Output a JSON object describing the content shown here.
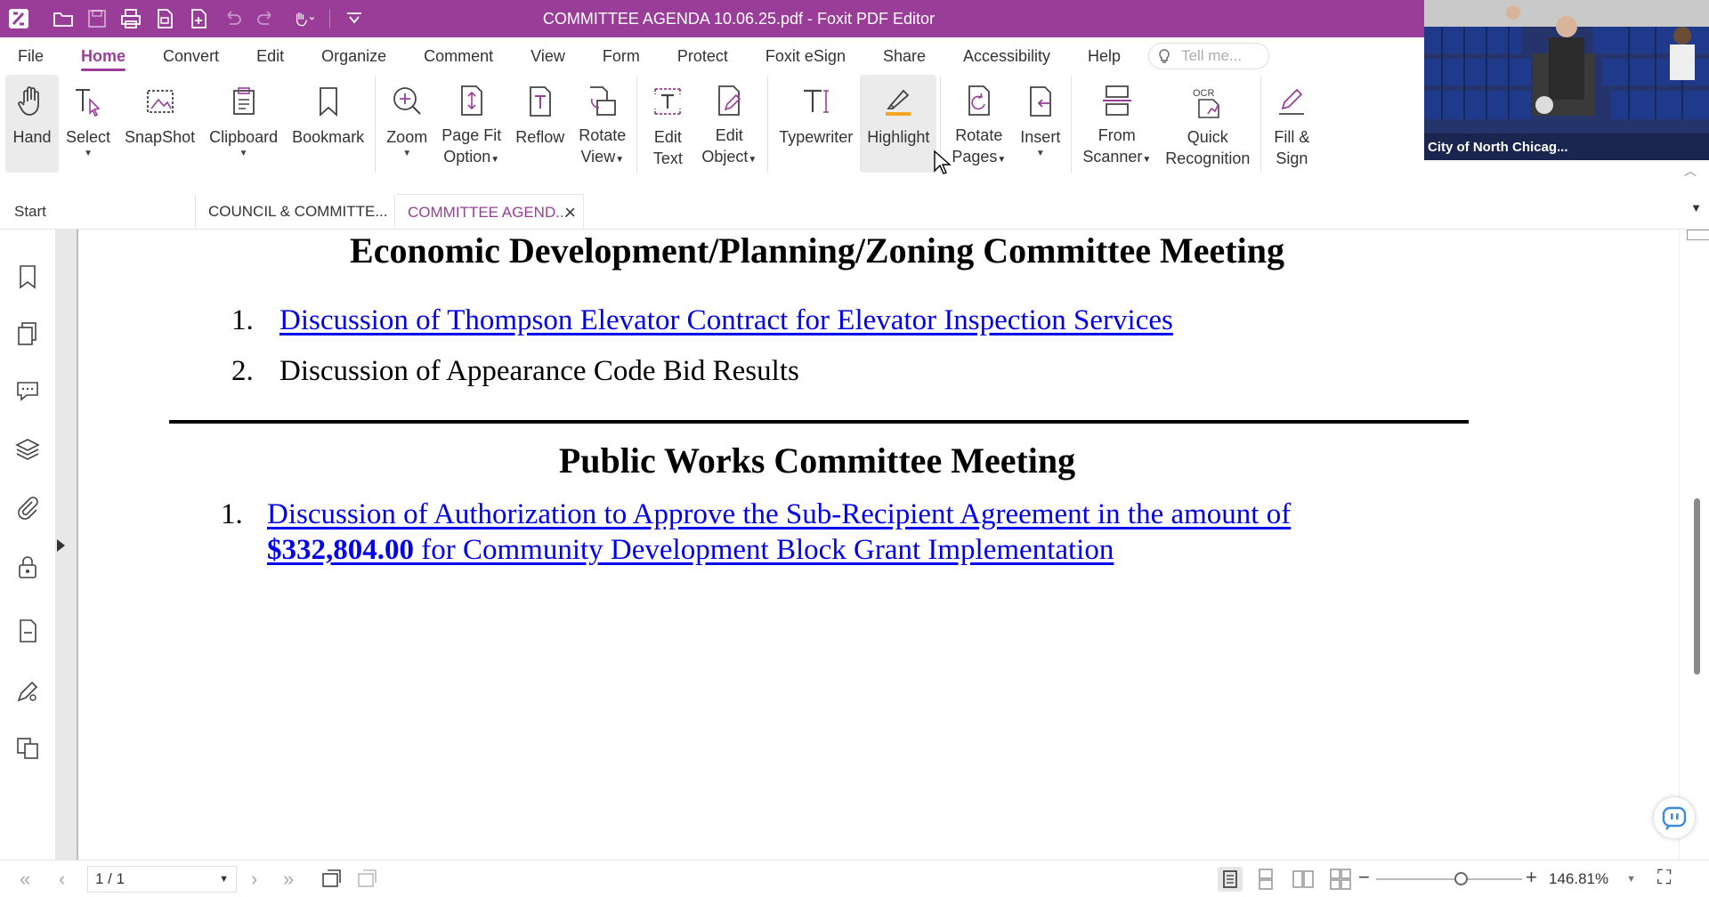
{
  "window": {
    "title": "COMMITTEE AGENDA 10.06.25.pdf - Foxit PDF Editor",
    "accent_color": "#993d99"
  },
  "quick_access": [
    "foxit-logo-icon",
    "open-folder-icon",
    "save-icon",
    "print-icon",
    "new-doc-icon",
    "create-icon",
    "undo-icon",
    "redo-icon",
    "hand-tool-icon",
    "customize-icon"
  ],
  "menu": {
    "items": [
      "File",
      "Home",
      "Convert",
      "Edit",
      "Organize",
      "Comment",
      "View",
      "Form",
      "Protect",
      "Foxit eSign",
      "Share",
      "Accessibility",
      "Help"
    ],
    "active": "Home",
    "tell_me_placeholder": "Tell me..."
  },
  "ribbon": {
    "hand": "Hand",
    "select": "Select",
    "snapshot": "SnapShot",
    "clipboard": "Clipboard",
    "bookmark": "Bookmark",
    "zoom": "Zoom",
    "page_fit_1": "Page Fit",
    "page_fit_2": "Option",
    "reflow": "Reflow",
    "rotate_view_1": "Rotate",
    "rotate_view_2": "View",
    "edit_text_1": "Edit",
    "edit_text_2": "Text",
    "edit_object_1": "Edit",
    "edit_object_2": "Object",
    "typewriter": "Typewriter",
    "highlight": "Highlight",
    "rotate_pages_1": "Rotate",
    "rotate_pages_2": "Pages",
    "insert": "Insert",
    "from_scanner_1": "From",
    "from_scanner_2": "Scanner",
    "quick_recognition_1": "Quick",
    "quick_recognition_2": "Recognition",
    "fill_sign_1": "Fill &",
    "fill_sign_2": "Sign",
    "ocr_label": "OCR"
  },
  "video": {
    "label": "City of North Chicag..."
  },
  "tabs": {
    "start": "Start",
    "tab1": "COUNCIL & COMMITTE...",
    "tab2": "COMMITTEE AGEND..."
  },
  "document": {
    "section1_title": "Economic Development/Planning/Zoning Committee Meeting",
    "section1_items": [
      {
        "num": "1.",
        "text": "Discussion of Thompson Elevator Contract for Elevator Inspection Services"
      },
      {
        "num": "2.",
        "text": "Discussion of Appearance Code Bid Results"
      }
    ],
    "section2_title": "Public Works Committee Meeting",
    "section2_item": {
      "num": "1.",
      "line1": "Discussion of Authorization to Approve the Sub-Recipient Agreement in the amount of",
      "line2_bold": "$332,804.00",
      "line2_rest": " for Community Development Block Grant Implementation"
    },
    "link_color": "#0000ee"
  },
  "status": {
    "page": "1 / 1",
    "zoom": "146.81%"
  }
}
